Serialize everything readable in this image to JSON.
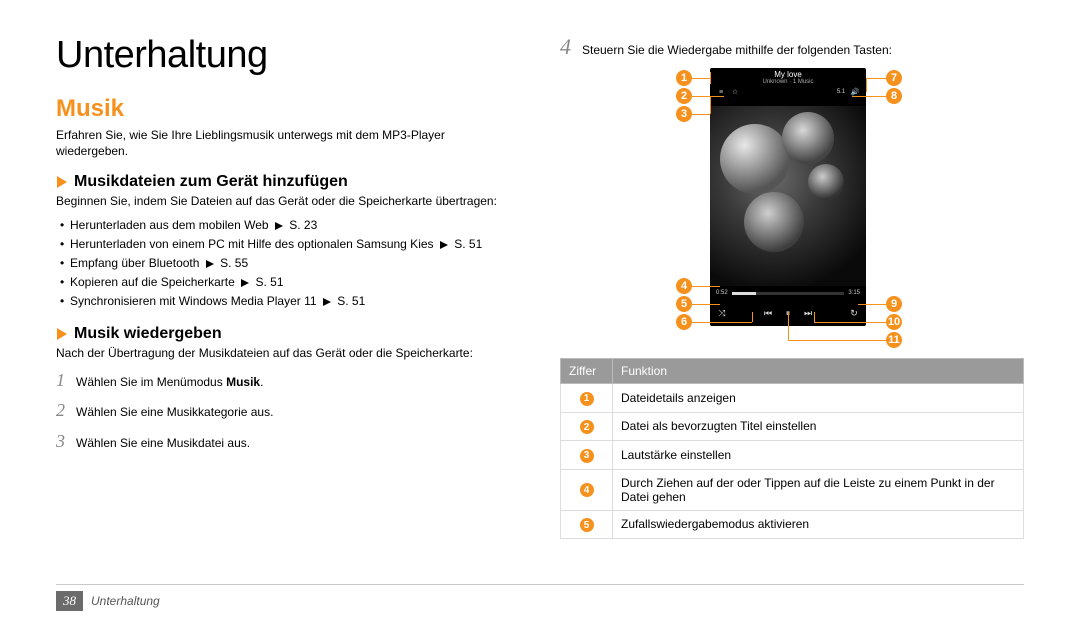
{
  "page_title": "Unterhaltung",
  "section_title": "Musik",
  "intro": "Erfahren Sie, wie Sie Ihre Lieblingsmusik unterwegs mit dem MP3-Player wiedergeben.",
  "sub1_title": "Musikdateien zum Gerät hinzufügen",
  "sub1_intro": "Beginnen Sie, indem Sie Dateien auf das Gerät oder die Speicherkarte übertragen:",
  "bullets": [
    {
      "text": "Herunterladen aus dem mobilen Web",
      "ref": "S. 23"
    },
    {
      "text": "Herunterladen von einem PC mit Hilfe des optionalen Samsung Kies",
      "ref": "S. 51"
    },
    {
      "text": "Empfang über Bluetooth",
      "ref": "S. 55"
    },
    {
      "text": "Kopieren auf die Speicherkarte",
      "ref": "S. 51"
    },
    {
      "text": "Synchronisieren mit Windows Media Player 11",
      "ref": "S. 51"
    }
  ],
  "sub2_title": "Musik wiedergeben",
  "sub2_intro": "Nach der Übertragung der Musikdateien auf das Gerät oder die Speicherkarte:",
  "steps": [
    {
      "n": "1",
      "text_pre": "Wählen Sie im Menümodus ",
      "bold": "Musik",
      "text_post": "."
    },
    {
      "n": "2",
      "text_pre": "Wählen Sie eine Musikkategorie aus.",
      "bold": "",
      "text_post": ""
    },
    {
      "n": "3",
      "text_pre": "Wählen Sie eine Musikdatei aus.",
      "bold": "",
      "text_post": ""
    }
  ],
  "step4": {
    "n": "4",
    "text": "Steuern Sie die Wiedergabe mithilfe der folgenden Tasten:"
  },
  "phone": {
    "track_title": "My love",
    "track_sub": "Unknown · 1 Music",
    "time_cur": "0:52",
    "time_tot": "3:15",
    "vol": "5.1"
  },
  "callouts_left": [
    "1",
    "2",
    "3",
    "4",
    "5",
    "6"
  ],
  "callouts_right": [
    "7",
    "8",
    "9",
    "10",
    "11"
  ],
  "table": {
    "head_ziffer": "Ziffer",
    "head_func": "Funktion",
    "rows": [
      {
        "n": "1",
        "txt": "Dateidetails anzeigen"
      },
      {
        "n": "2",
        "txt": "Datei als bevorzugten Titel einstellen"
      },
      {
        "n": "3",
        "txt": "Lautstärke einstellen"
      },
      {
        "n": "4",
        "txt": "Durch Ziehen auf der oder Tippen auf die Leiste zu einem Punkt in der Datei gehen"
      },
      {
        "n": "5",
        "txt": "Zufallswiedergabemodus aktivieren"
      }
    ]
  },
  "footer": {
    "page_num": "38",
    "label": "Unterhaltung"
  }
}
